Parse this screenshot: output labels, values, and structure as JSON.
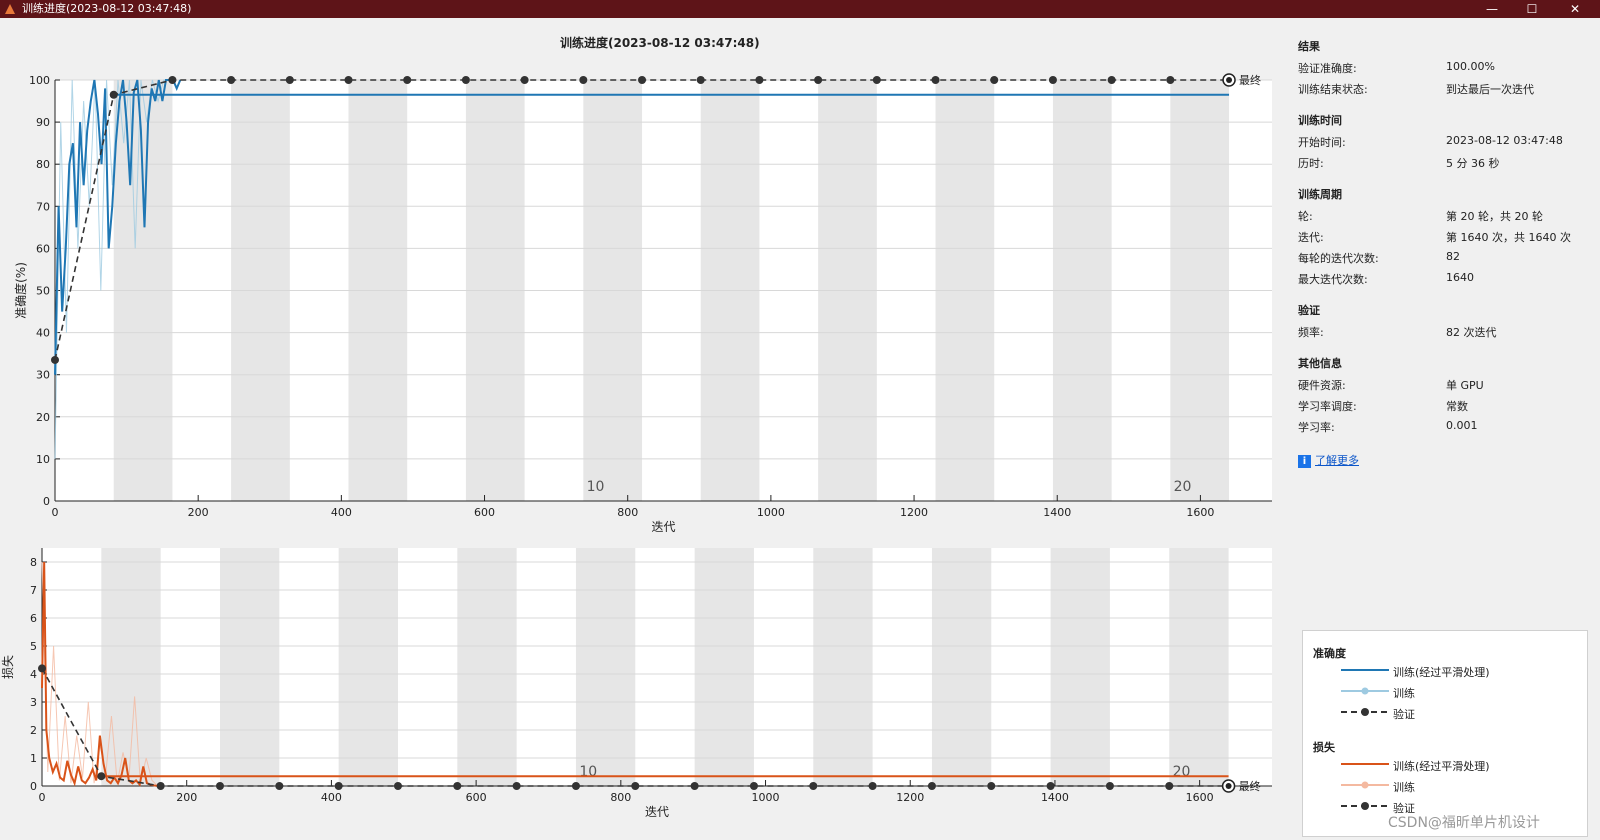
{
  "window": {
    "title": "训练进度(2023-08-12 03:47:48)",
    "min_icon": "minimize-icon",
    "max_icon": "maximize-icon",
    "close_icon": "close-icon",
    "min_glyph": "—",
    "max_glyph": "☐",
    "close_glyph": "✕"
  },
  "plot_title": "训练进度(2023-08-12 03:47:48)",
  "colors": {
    "acc": "#1f77b4",
    "acc_raw": "#9ecae1",
    "loss": "#d95319",
    "loss_raw": "#f4b9a0",
    "val": "#333333",
    "band": "#e6e6e6",
    "titlebar": "#5e1418"
  },
  "chart_data": [
    {
      "type": "line",
      "title": "",
      "xlabel": "迭代",
      "ylabel": "准确度(%)",
      "xlim": [
        0,
        1700
      ],
      "ylim": [
        0,
        100
      ],
      "xticks": [
        0,
        200,
        400,
        600,
        800,
        1000,
        1200,
        1400,
        1600
      ],
      "yticks": [
        0,
        10,
        20,
        30,
        40,
        50,
        60,
        70,
        80,
        90,
        100
      ],
      "epoch_length": 82,
      "epoch_labels": [
        {
          "epoch": 10,
          "x": 755
        },
        {
          "epoch": 20,
          "x": 1575
        }
      ],
      "final_label": "最终",
      "series": [
        {
          "name": "训练(经过平滑处理)",
          "x": [
            0,
            5,
            10,
            15,
            20,
            25,
            30,
            35,
            40,
            45,
            50,
            55,
            60,
            65,
            70,
            75,
            80,
            85,
            90,
            95,
            100,
            105,
            110,
            115,
            120,
            125,
            130,
            135,
            140,
            145,
            150,
            155,
            160,
            165,
            170,
            175
          ],
          "y": [
            30,
            70,
            45,
            60,
            80,
            85,
            65,
            90,
            75,
            88,
            95,
            100,
            92,
            80,
            98,
            60,
            70,
            85,
            95,
            100,
            90,
            75,
            97,
            100,
            88,
            65,
            90,
            98,
            95,
            100,
            95,
            100,
            100,
            100,
            98,
            100
          ]
        },
        {
          "name": "训练",
          "x": [
            0,
            8,
            16,
            24,
            32,
            40,
            48,
            56,
            64,
            72,
            80,
            88,
            96,
            104,
            112,
            120,
            128,
            136,
            144,
            152,
            160
          ],
          "y": [
            10,
            90,
            40,
            100,
            60,
            95,
            70,
            100,
            50,
            100,
            75,
            100,
            85,
            100,
            60,
            100,
            90,
            100,
            95,
            100,
            100
          ]
        },
        {
          "name": "验证",
          "x": [
            0,
            82,
            164,
            246,
            328,
            410,
            492,
            574,
            656,
            738,
            820,
            902,
            984,
            1066,
            1148,
            1230,
            1312,
            1394,
            1476,
            1558,
            1640
          ],
          "y": [
            33.5,
            96.5,
            100,
            100,
            100,
            100,
            100,
            100,
            100,
            100,
            100,
            100,
            100,
            100,
            100,
            100,
            100,
            100,
            100,
            100,
            100
          ]
        }
      ]
    },
    {
      "type": "line",
      "title": "",
      "xlabel": "迭代",
      "ylabel": "损失",
      "xlim": [
        0,
        1700
      ],
      "ylim": [
        0,
        8.5
      ],
      "xticks": [
        0,
        200,
        400,
        600,
        800,
        1000,
        1200,
        1400,
        1600
      ],
      "yticks": [
        0,
        1,
        2,
        3,
        4,
        5,
        6,
        7,
        8
      ],
      "epoch_length": 82,
      "epoch_labels": [
        {
          "epoch": 10,
          "x": 755
        },
        {
          "epoch": 20,
          "x": 1575
        }
      ],
      "final_label": "最终",
      "series": [
        {
          "name": "训练(经过平滑处理)",
          "x": [
            0,
            3,
            6,
            10,
            15,
            20,
            25,
            30,
            35,
            40,
            45,
            50,
            55,
            60,
            65,
            70,
            75,
            80,
            85,
            90,
            95,
            100,
            105,
            110,
            115,
            120,
            125,
            130,
            135,
            140,
            145,
            150,
            155,
            160
          ],
          "y": [
            3.5,
            8,
            2,
            1,
            0.5,
            0.8,
            0.3,
            0.2,
            0.9,
            0.4,
            0.1,
            0.7,
            0.2,
            0.1,
            0.3,
            0.6,
            0.2,
            1.8,
            0.8,
            0.2,
            0.1,
            0.3,
            0.1,
            0.4,
            1.0,
            0.2,
            0.1,
            0.2,
            0.05,
            0.7,
            0.1,
            0.05,
            0.02,
            0
          ]
        },
        {
          "name": "训练",
          "x": [
            0,
            8,
            16,
            24,
            32,
            40,
            48,
            56,
            64,
            72,
            80,
            88,
            96,
            104,
            112,
            120,
            128,
            136,
            144,
            152,
            160
          ],
          "y": [
            8,
            0.5,
            5,
            0.2,
            2.5,
            0.1,
            1.8,
            0.3,
            3.0,
            0.1,
            1.5,
            0.4,
            2.5,
            0.1,
            1.2,
            0.2,
            3.2,
            0.1,
            1.0,
            0.2,
            0
          ]
        },
        {
          "name": "验证",
          "x": [
            0,
            82,
            164,
            246,
            328,
            410,
            492,
            574,
            656,
            738,
            820,
            902,
            984,
            1066,
            1148,
            1230,
            1312,
            1394,
            1476,
            1558,
            1640
          ],
          "y": [
            4.2,
            0.35,
            0,
            0,
            0,
            0,
            0,
            0,
            0,
            0,
            0,
            0,
            0,
            0,
            0,
            0,
            0,
            0,
            0,
            0,
            0
          ]
        }
      ]
    }
  ],
  "panel": {
    "results": {
      "title": "结果",
      "val_acc_label": "验证准确度:",
      "val_acc": "100.00%",
      "status_label": "训练结束状态:",
      "status": "到达最后一次迭代"
    },
    "time": {
      "title": "训练时间",
      "start_label": "开始时间:",
      "start": "2023-08-12 03:47:48",
      "elapsed_label": "历时:",
      "elapsed": "5 分 36 秒"
    },
    "cycle": {
      "title": "训练周期",
      "epoch_label": "轮:",
      "epoch": "第 20 轮，共 20 轮",
      "iter_label": "迭代:",
      "iter": "第 1640 次，共 1640 次",
      "per_epoch_label": "每轮的迭代次数:",
      "per_epoch": "82",
      "max_iter_label": "最大迭代次数:",
      "max_iter": "1640"
    },
    "validation": {
      "title": "验证",
      "freq_label": "频率:",
      "freq": "82 次迭代"
    },
    "other": {
      "title": "其他信息",
      "hw_label": "硬件资源:",
      "hw": "单 GPU",
      "lr_sched_label": "学习率调度:",
      "lr_sched": "常数",
      "lr_label": "学习率:",
      "lr": "0.001"
    },
    "more": {
      "icon": "info-icon",
      "icon_glyph": "i",
      "label": "了解更多"
    }
  },
  "legend": {
    "acc_title": "准确度",
    "loss_title": "损失",
    "smoothed": "训练(经过平滑处理)",
    "train": "训练",
    "val": "验证"
  },
  "watermark": "CSDN@福昕单片机设计"
}
